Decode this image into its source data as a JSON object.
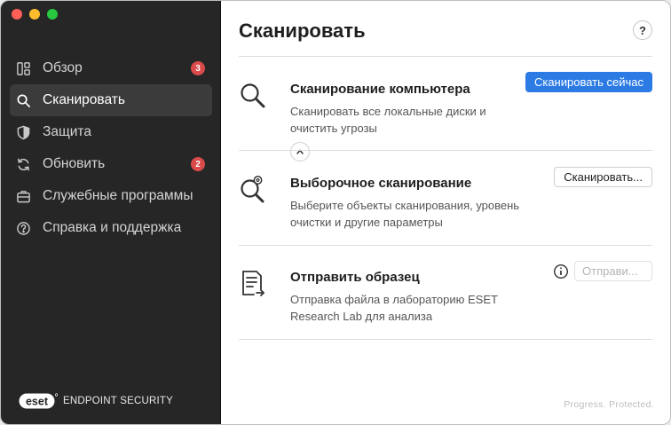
{
  "sidebar": {
    "items": [
      {
        "label": "Обзор",
        "badge": "3",
        "icon": "dashboard-icon"
      },
      {
        "label": "Сканировать",
        "badge": null,
        "icon": "search-icon"
      },
      {
        "label": "Защита",
        "badge": null,
        "icon": "shield-icon"
      },
      {
        "label": "Обновить",
        "badge": "2",
        "icon": "refresh-icon"
      },
      {
        "label": "Служебные программы",
        "badge": null,
        "icon": "briefcase-icon"
      },
      {
        "label": "Справка и поддержка",
        "badge": null,
        "icon": "help-circle-icon"
      }
    ],
    "active_index": 1,
    "brand_logo": "eset",
    "brand_product": "ENDPOINT SECURITY"
  },
  "main": {
    "title": "Сканировать",
    "help_label": "?",
    "scans": [
      {
        "title": "Сканирование компьютера",
        "description": "Сканировать все локальные диски и очистить угрозы",
        "button": "Сканировать сейчас",
        "icon": "magnifier-icon"
      },
      {
        "title": "Выборочное сканирование",
        "description": "Выберите объекты сканирования, уровень очистки и другие параметры",
        "button": "Сканировать...",
        "icon": "magnifier-gear-icon"
      },
      {
        "title": "Отправить образец",
        "description": "Отправка файла в лабораторию ESET Research Lab для анализа",
        "button": "Отправи...",
        "icon": "document-send-icon"
      }
    ],
    "tagline": "Progress. Protected."
  },
  "colors": {
    "sidebar_bg": "#262626",
    "primary_button": "#2c7be5",
    "badge": "#d94a4a"
  }
}
